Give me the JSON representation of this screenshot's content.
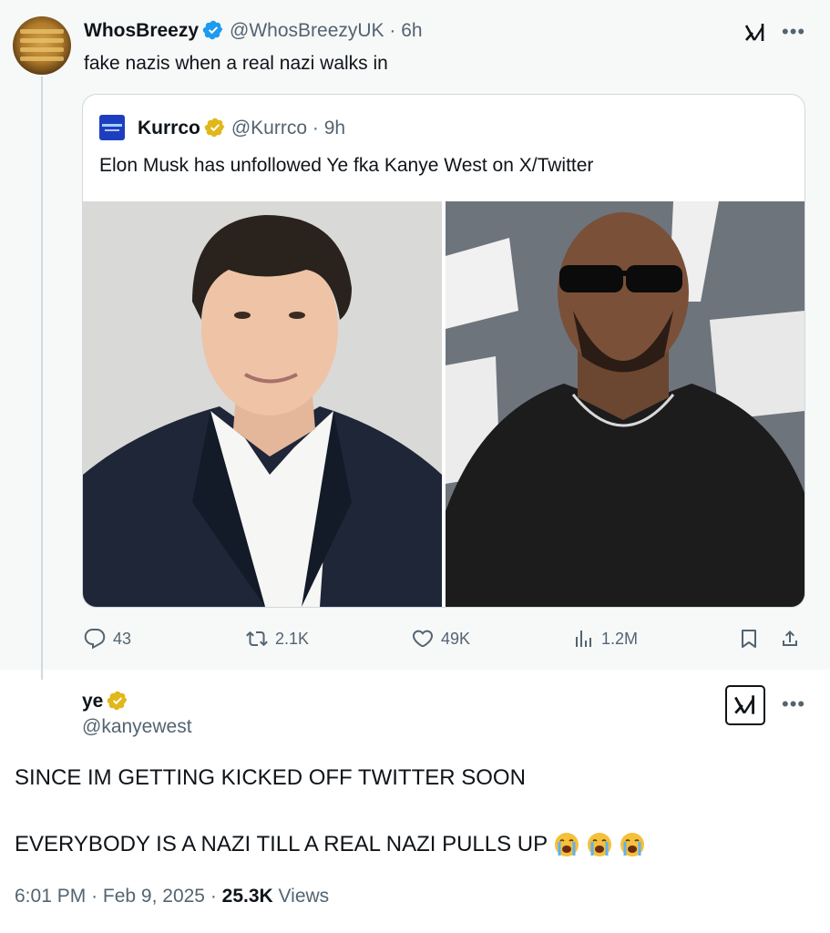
{
  "colors": {
    "accent_blue": "#1d9bf0",
    "gold": "#e2b719",
    "muted": "#536471"
  },
  "top_tweet": {
    "name": "WhosBreezy",
    "handle": "@WhosBreezyUK",
    "time": "· 6h",
    "text": "fake nazis when a real nazi walks in",
    "grok_icon": "grok-icon",
    "more_icon": "more-icon"
  },
  "quoted_tweet": {
    "name": "Kurrco",
    "handle": "@Kurrco",
    "time": "· 9h",
    "text": "Elon Musk has unfollowed Ye fka Kanye West on X/Twitter"
  },
  "actions": {
    "replies": "43",
    "reposts": "2.1K",
    "likes": "49K",
    "views": "1.2M"
  },
  "bottom_tweet": {
    "name": "ye",
    "handle": "@kanyewest",
    "line1": "SINCE IM GETTING KICKED OFF TWITTER SOON",
    "line2": "EVERYBODY IS A NAZI TILL A REAL NAZI PULLS UP",
    "emoji_icon": "loudly-crying-face-icon",
    "time": "6:01 PM",
    "date": "Feb 9, 2025",
    "view_count": "25.3K",
    "views_label": "Views"
  }
}
